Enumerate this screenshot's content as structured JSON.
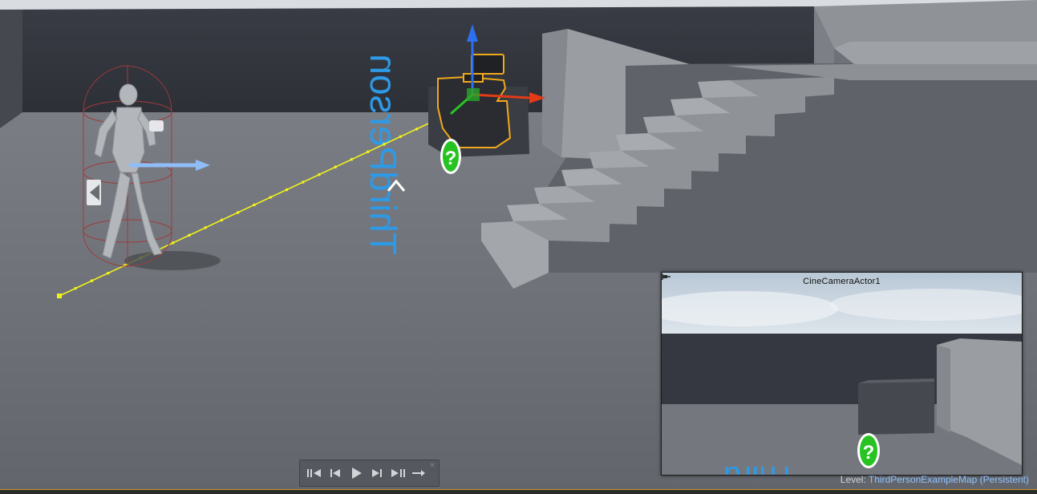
{
  "viewport": {
    "name": "Level Editor Viewport"
  },
  "scene": {
    "floor_decal_text": "ThirdPerson",
    "question_icon_glyph": "?",
    "actors": [
      {
        "name": "character-mannequin",
        "icon": "mannequin-icon"
      },
      {
        "name": "cine-camera-actor",
        "icon": "camera-icon"
      }
    ]
  },
  "pip": {
    "title": "CineCameraActor1",
    "decal_text": "Third",
    "question_glyph": "?",
    "pin_icon": "pin-icon"
  },
  "transport": {
    "buttons": [
      {
        "name": "jump-to-start-button",
        "icon": "skip-back-icon"
      },
      {
        "name": "step-back-button",
        "icon": "step-back-icon"
      },
      {
        "name": "play-button",
        "icon": "play-icon"
      },
      {
        "name": "step-forward-button",
        "icon": "step-forward-icon"
      },
      {
        "name": "jump-to-end-button",
        "icon": "skip-forward-icon"
      },
      {
        "name": "loop-button",
        "icon": "loop-arrow-icon"
      }
    ],
    "close_glyph": "×"
  },
  "status": {
    "level_label": "Level:",
    "level_name": "ThirdPersonExampleMap (Persistent)"
  },
  "colors": {
    "axis_x": "#e23b16",
    "axis_y": "#27c421",
    "axis_z": "#2e6ff0",
    "selection_outline": "#f0a91c",
    "camera_path": "#f2f21b",
    "decal_blue": "#2e9ae6",
    "level_name": "#8ec1ff"
  }
}
